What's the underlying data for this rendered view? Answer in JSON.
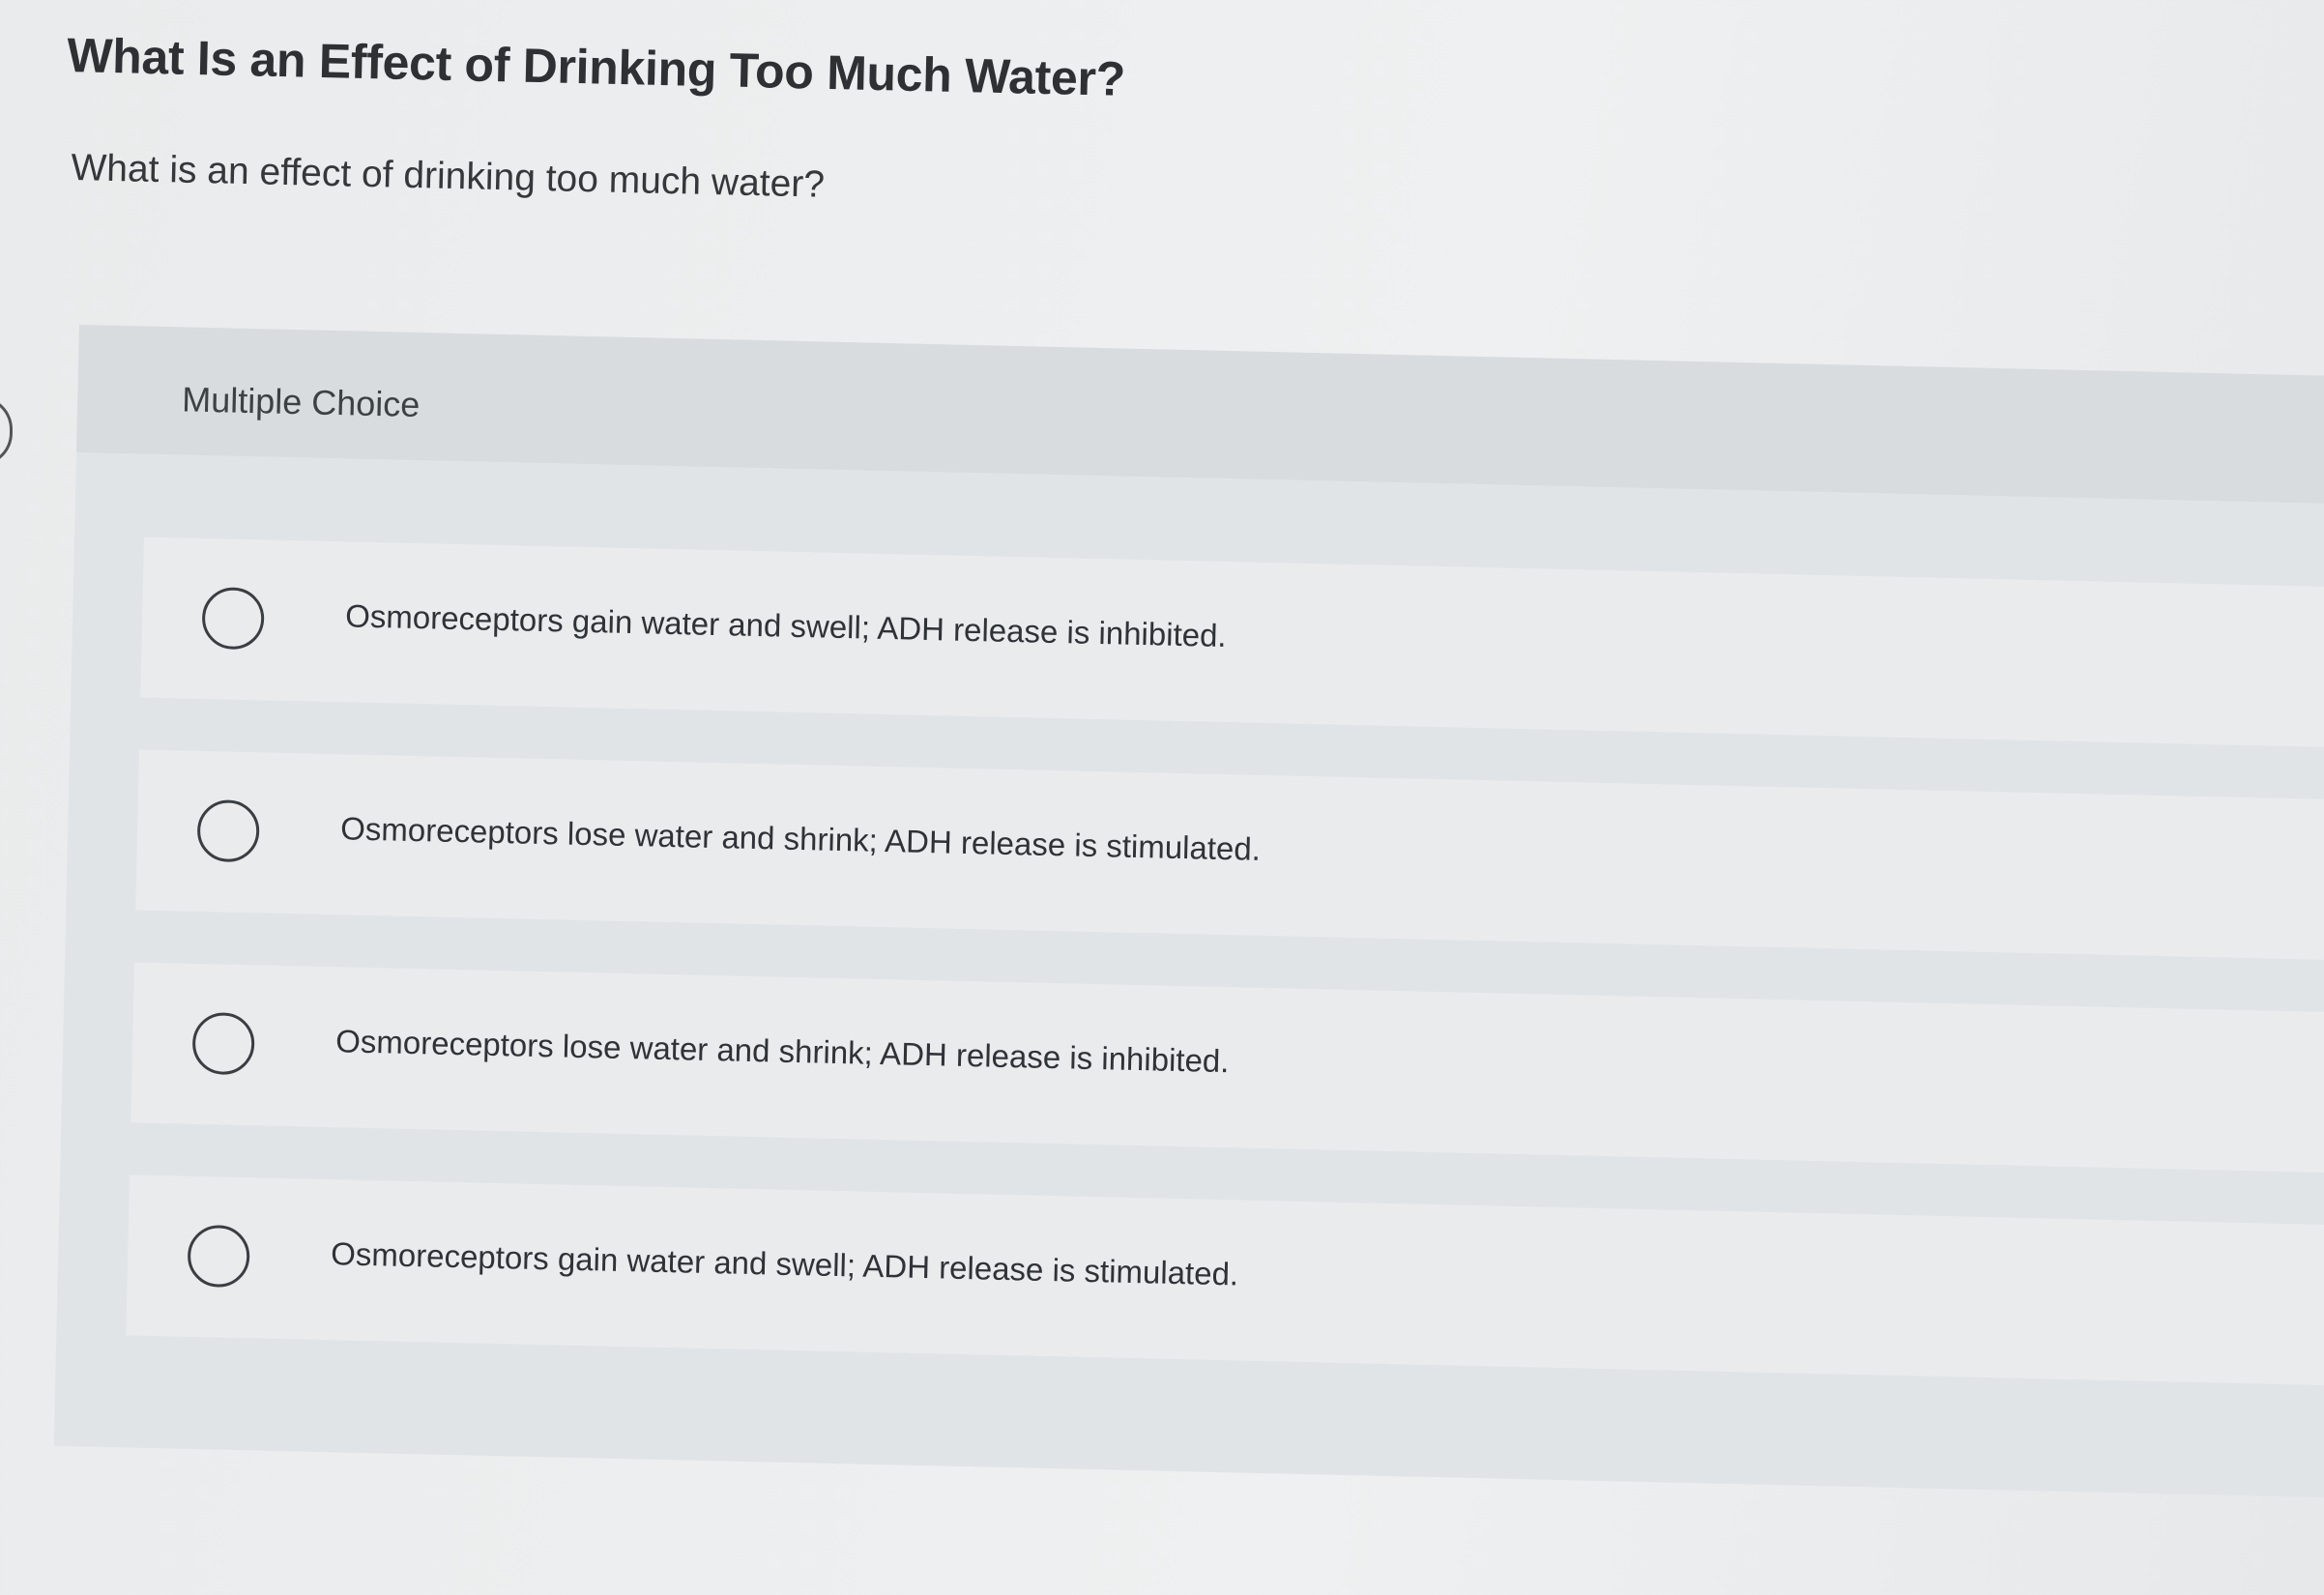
{
  "page": {
    "title": "What Is an Effect of Drinking Too Much Water?",
    "question": "What is an effect of drinking too much water?"
  },
  "multiple_choice": {
    "label": "Multiple Choice",
    "options": [
      {
        "text": "Osmoreceptors gain water and swell; ADH release is inhibited.",
        "selected": false
      },
      {
        "text": "Osmoreceptors lose water and shrink; ADH release is stimulated.",
        "selected": false
      },
      {
        "text": "Osmoreceptors lose water and shrink; ADH release is inhibited.",
        "selected": false
      },
      {
        "text": "Osmoreceptors gain water and swell; ADH release is stimulated.",
        "selected": false
      }
    ]
  }
}
